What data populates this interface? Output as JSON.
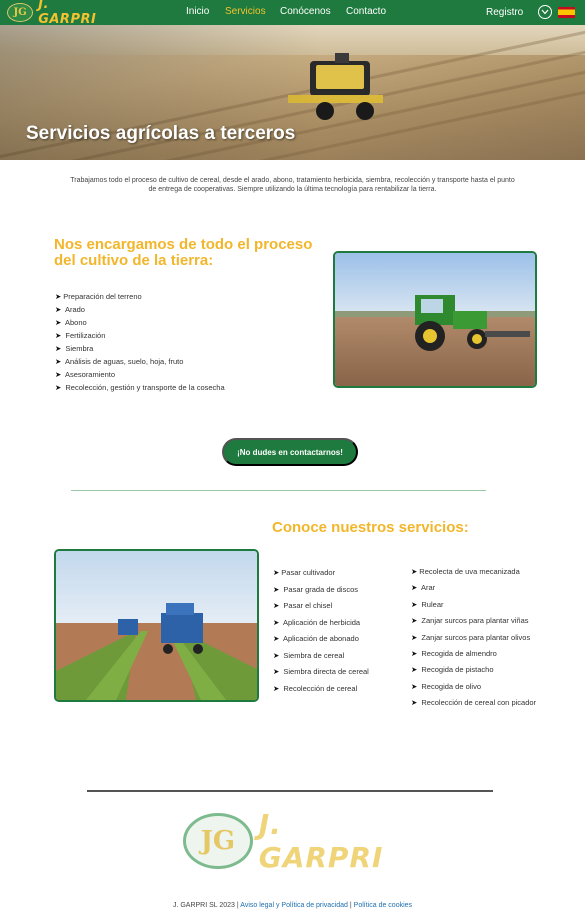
{
  "nav": {
    "logo_text": "J. GARPRI",
    "logo_monogram": "JG",
    "items": [
      {
        "label": "Inicio",
        "active": false
      },
      {
        "label": "Servicios",
        "active": true
      },
      {
        "label": "Conócenos",
        "active": false
      },
      {
        "label": "Contacto",
        "active": false
      }
    ],
    "register_label": "Registro",
    "language_flag": "spain-flag-icon",
    "accent_color": "#f2c230",
    "bar_color": "#1e7a3e"
  },
  "hero": {
    "title": "Servicios agrícolas a terceros"
  },
  "intro": {
    "text": "Trabajamos todo el proceso de cultivo de cereal, desde el arado, abono, tratamiento herbicida, siembra, recolección y transporte hasta el punto de entrega de cooperativas. Siempre utilizando la última tecnología para rentabilizar la tierra."
  },
  "process": {
    "heading": "Nos encargamos de todo el proceso del cultivo de la tierra:",
    "items": [
      "Preparación del terreno",
      "Arado",
      "Abono",
      "Fertilización",
      "Siembra",
      "Análisis de aguas, suelo, hoja, fruto",
      "Asesoramiento",
      "Recolección, gestión y transporte de la cosecha"
    ]
  },
  "cta": {
    "label": "¡No dudes en contactarnos!"
  },
  "services": {
    "heading": "Conoce nuestros servicios:",
    "column1": [
      "Pasar cultivador",
      "Pasar grada de discos",
      "Pasar el chisel",
      "Aplicación de herbicida",
      "Aplicación de abonado",
      "Siembra de cereal",
      "Siembra directa de cereal",
      "Recolección de cereal"
    ],
    "column2": [
      "Recolecta de uva mecanizada",
      "Arar",
      "Rulear",
      "Zanjar surcos para plantar viñas",
      "Zanjar surcos para plantar olivos",
      "Recogida de almendro",
      "Recogida de pistacho",
      "Recogida de olivo",
      "Recolección de cereal con picador"
    ]
  },
  "footer": {
    "copyright": "J. GARPRI SL 2023 |",
    "legal_link": "Aviso legal y Política de privacidad",
    "separator": "|",
    "cookies_link": "Política de cookies",
    "logo_text": "J. GARPRI",
    "logo_monogram": "JG"
  }
}
